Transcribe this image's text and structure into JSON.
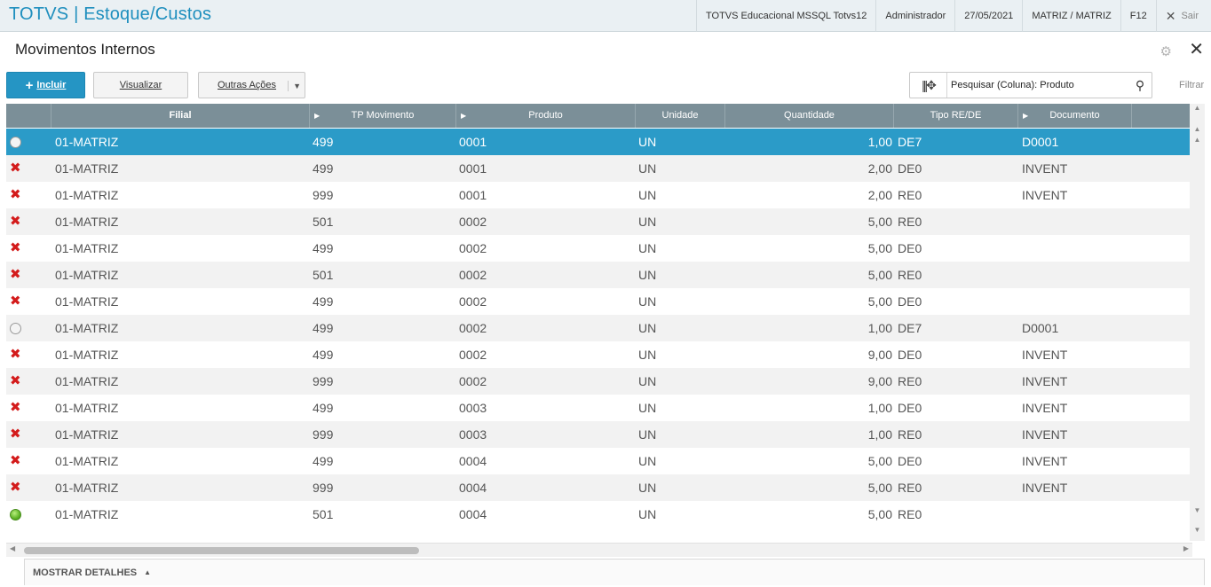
{
  "app": {
    "title": "TOTVS | Estoque/Custos",
    "environment": "TOTVS Educacional MSSQL Totvs12",
    "user": "Administrador",
    "date": "27/05/2021",
    "branch": "MATRIZ / MATRIZ",
    "shortcut": "F12",
    "exit_label": "Sair"
  },
  "window": {
    "title": "Movimentos Internos"
  },
  "toolbar": {
    "incluir_label": "Incluir",
    "visualizar_label": "Visualizar",
    "outras_label": "Outras Ações",
    "search_text": "Pesquisar (Coluna): Produto",
    "filtrar_label": "Filtrar"
  },
  "grid": {
    "columns": [
      "Filial",
      "TP Movimento",
      "Produto",
      "Unidade",
      "Quantidade",
      "Tipo RE/DE",
      "Documento"
    ],
    "rows": [
      {
        "status": "white",
        "filial": "01-MATRIZ",
        "tp": "499",
        "produto": "0001",
        "unidade": "UN",
        "qtd": "1,00",
        "tipo": "DE7",
        "doc": "D0001"
      },
      {
        "status": "x",
        "filial": "01-MATRIZ",
        "tp": "499",
        "produto": "0001",
        "unidade": "UN",
        "qtd": "2,00",
        "tipo": "DE0",
        "doc": "INVENT"
      },
      {
        "status": "x",
        "filial": "01-MATRIZ",
        "tp": "999",
        "produto": "0001",
        "unidade": "UN",
        "qtd": "2,00",
        "tipo": "RE0",
        "doc": "INVENT"
      },
      {
        "status": "x",
        "filial": "01-MATRIZ",
        "tp": "501",
        "produto": "0002",
        "unidade": "UN",
        "qtd": "5,00",
        "tipo": "RE0",
        "doc": ""
      },
      {
        "status": "x",
        "filial": "01-MATRIZ",
        "tp": "499",
        "produto": "0002",
        "unidade": "UN",
        "qtd": "5,00",
        "tipo": "DE0",
        "doc": ""
      },
      {
        "status": "x",
        "filial": "01-MATRIZ",
        "tp": "501",
        "produto": "0002",
        "unidade": "UN",
        "qtd": "5,00",
        "tipo": "RE0",
        "doc": ""
      },
      {
        "status": "x",
        "filial": "01-MATRIZ",
        "tp": "499",
        "produto": "0002",
        "unidade": "UN",
        "qtd": "5,00",
        "tipo": "DE0",
        "doc": ""
      },
      {
        "status": "white",
        "filial": "01-MATRIZ",
        "tp": "499",
        "produto": "0002",
        "unidade": "UN",
        "qtd": "1,00",
        "tipo": "DE7",
        "doc": "D0001"
      },
      {
        "status": "x",
        "filial": "01-MATRIZ",
        "tp": "499",
        "produto": "0002",
        "unidade": "UN",
        "qtd": "9,00",
        "tipo": "DE0",
        "doc": "INVENT"
      },
      {
        "status": "x",
        "filial": "01-MATRIZ",
        "tp": "999",
        "produto": "0002",
        "unidade": "UN",
        "qtd": "9,00",
        "tipo": "RE0",
        "doc": "INVENT"
      },
      {
        "status": "x",
        "filial": "01-MATRIZ",
        "tp": "499",
        "produto": "0003",
        "unidade": "UN",
        "qtd": "1,00",
        "tipo": "DE0",
        "doc": "INVENT"
      },
      {
        "status": "x",
        "filial": "01-MATRIZ",
        "tp": "999",
        "produto": "0003",
        "unidade": "UN",
        "qtd": "1,00",
        "tipo": "RE0",
        "doc": "INVENT"
      },
      {
        "status": "x",
        "filial": "01-MATRIZ",
        "tp": "499",
        "produto": "0004",
        "unidade": "UN",
        "qtd": "5,00",
        "tipo": "DE0",
        "doc": "INVENT"
      },
      {
        "status": "x",
        "filial": "01-MATRIZ",
        "tp": "999",
        "produto": "0004",
        "unidade": "UN",
        "qtd": "5,00",
        "tipo": "RE0",
        "doc": "INVENT"
      },
      {
        "status": "green",
        "filial": "01-MATRIZ",
        "tp": "501",
        "produto": "0004",
        "unidade": "UN",
        "qtd": "5,00",
        "tipo": "RE0",
        "doc": ""
      }
    ]
  },
  "footer": {
    "details_label": "MOSTRAR DETALHES"
  },
  "colors": {
    "brand": "#1f8fbe",
    "primary_button": "#2595c4",
    "header": "#7b8f98",
    "selected_row": "#2b9bc8",
    "error_icon": "#d31b1b"
  }
}
